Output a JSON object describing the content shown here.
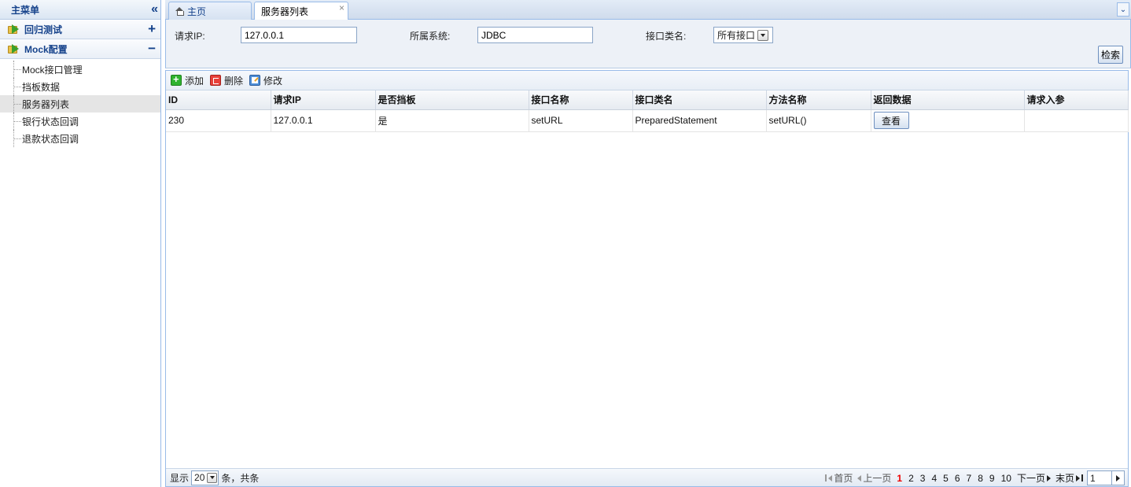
{
  "sidebar": {
    "title": "主菜单",
    "collapse_icon": "double-chevron-left-icon",
    "groups": [
      {
        "label": "回归测试",
        "toggle": "+"
      },
      {
        "label": "Mock配置",
        "toggle": "−"
      }
    ],
    "items": [
      {
        "label": "Mock接口管理"
      },
      {
        "label": "挡板数据"
      },
      {
        "label": "服务器列表"
      },
      {
        "label": "银行状态回调"
      },
      {
        "label": "退款状态回调"
      }
    ],
    "active_item": "服务器列表"
  },
  "tabs": [
    {
      "label": "主页",
      "icon": "home-icon"
    },
    {
      "label": "服务器列表",
      "close": "×"
    }
  ],
  "search": {
    "ip_label": "请求IP:",
    "ip_value": "127.0.0.1",
    "system_label": "所属系统:",
    "system_value": "JDBC",
    "class_label": "接口类名:",
    "class_value": "所有接口",
    "search_button": "检索"
  },
  "toolbar": {
    "add": "添加",
    "delete": "删除",
    "edit": "修改"
  },
  "table": {
    "columns": [
      "ID",
      "请求IP",
      "是否挡板",
      "接口名称",
      "接口类名",
      "方法名称",
      "返回数据",
      "请求入参"
    ],
    "rows": [
      {
        "id": "230",
        "ip": "127.0.0.1",
        "is_stub": "是",
        "interface_name": "setURL",
        "class_name": "PreparedStatement",
        "method_name": "setURL()",
        "return_button": "查看",
        "request_params": ""
      }
    ]
  },
  "pager": {
    "show_label": "显示",
    "page_size": "20",
    "suffix": "条，共条",
    "first": "首页",
    "prev": "上一页",
    "pages": [
      "1",
      "2",
      "3",
      "4",
      "5",
      "6",
      "7",
      "8",
      "9",
      "10"
    ],
    "current_page": "1",
    "next": "下一页",
    "last": "末页",
    "page_input": "1"
  },
  "colors": {
    "accent": "#15428b",
    "border": "#99bbe8",
    "current_page": "#ee0000"
  }
}
